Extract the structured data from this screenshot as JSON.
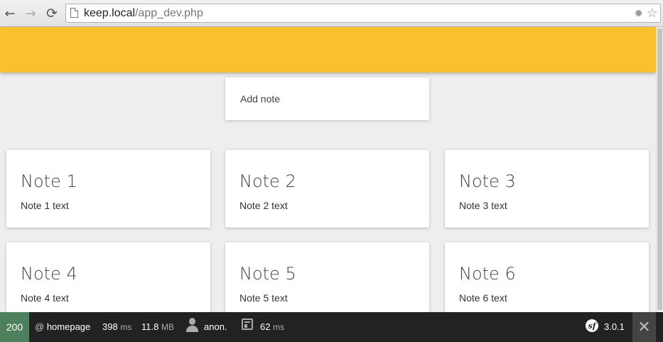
{
  "browser": {
    "url_host": "keep.local",
    "url_path": "/app_dev.php",
    "back_icon": "←",
    "forward_icon": "→",
    "reload_icon": "⟳",
    "star_icon": "☆",
    "extension_icon": "✹"
  },
  "header": {
    "color": "#fbc02d"
  },
  "add_note": {
    "placeholder": "Add note"
  },
  "notes": [
    {
      "title": "Note 1",
      "text": "Note 1 text"
    },
    {
      "title": "Note 2",
      "text": "Note 2 text"
    },
    {
      "title": "Note 3",
      "text": "Note 3 text"
    },
    {
      "title": "Note 4",
      "text": "Note 4 text"
    },
    {
      "title": "Note 5",
      "text": "Note 5 text"
    },
    {
      "title": "Note 6",
      "text": "Note 6 text"
    }
  ],
  "toolbar": {
    "status_code": "200",
    "route_prefix": "@",
    "route": "homepage",
    "time_value": "398",
    "time_unit": "ms",
    "memory_value": "11.8",
    "memory_unit": "MB",
    "user": "anon.",
    "render_value": "62",
    "render_unit": "ms",
    "symfony_logo": "sf",
    "version": "3.0.1",
    "close_icon": "✕",
    "status_color": "#4f805d"
  }
}
